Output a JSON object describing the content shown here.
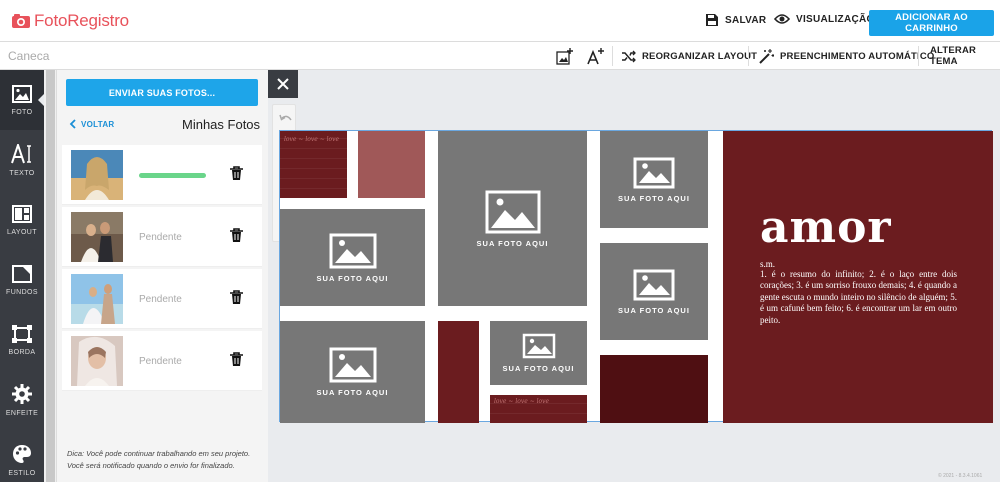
{
  "header": {
    "brand": "FotoRegistro",
    "save_label": "SALVAR",
    "preview_label": "VISUALIZAÇÃO",
    "cart_label": "ADICIONAR AO CARRINHO",
    "accent": "#1aa3e8",
    "brand_color": "#e8525b"
  },
  "toolbar": {
    "product_name": "Caneca",
    "reorganize_label": "REORGANIZAR LAYOUT",
    "autofill_label": "PREENCHIMENTO AUTOMÁTICO",
    "theme_label": "ALTERAR TEMA"
  },
  "sidebar": {
    "items": [
      {
        "label": "FOTO",
        "icon": "photo-icon"
      },
      {
        "label": "TEXTO",
        "icon": "text-icon"
      },
      {
        "label": "LAYOUT",
        "icon": "layout-icon"
      },
      {
        "label": "FUNDOS",
        "icon": "backgrounds-icon"
      },
      {
        "label": "BORDA",
        "icon": "border-icon"
      },
      {
        "label": "ENFEITE",
        "icon": "gear-icon"
      },
      {
        "label": "ESTILO",
        "icon": "palette-icon"
      }
    ]
  },
  "panel": {
    "send_button": "ENVIAR SUAS FOTOS...",
    "back_label": "VOLTAR",
    "title": "Minhas Fotos",
    "photos": [
      {
        "status": "uploading",
        "progress": 1.0
      },
      {
        "status": "Pendente"
      },
      {
        "status": "Pendente"
      },
      {
        "status": "Pendente"
      }
    ],
    "tip": "Dica: Você pode continuar trabalhando em seu projeto. Você será notificado quando o envio for finalizado."
  },
  "canvas": {
    "placeholder_label": "SUA FOTO AQUI",
    "pattern_text": "love ~ love ~ love",
    "word": "amor",
    "word_class": "s.m.",
    "definition": "1. é o resumo do infinito; 2. é o laço entre dois corações; 3. é um sorriso frouxo demais; 4. é quando a gente escuta o mundo inteiro no silêncio de alguém; 5. é um cafuné bem feito; 6. é encontrar um lar em outro peito."
  },
  "footer": {
    "copyright": "© 2021 - 8.3.4.1061"
  }
}
